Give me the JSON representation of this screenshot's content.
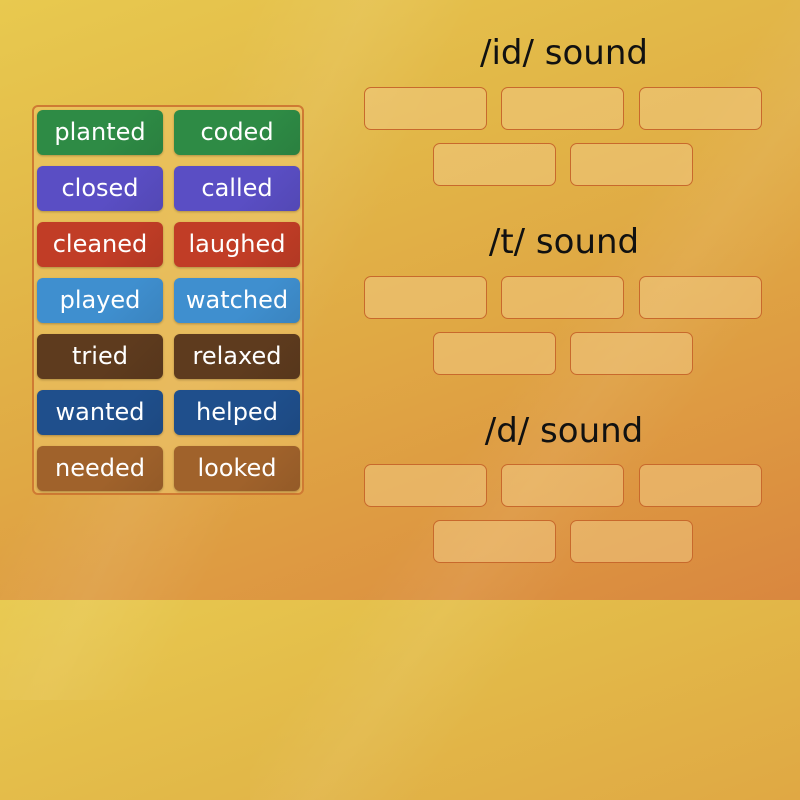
{
  "activity": "Group sort",
  "word_bank": {
    "tiles": [
      {
        "label": "planted",
        "color": "#2e8b45"
      },
      {
        "label": "coded",
        "color": "#2e8b45"
      },
      {
        "label": "closed",
        "color": "#5a4ec4"
      },
      {
        "label": "called",
        "color": "#5a4ec4"
      },
      {
        "label": "cleaned",
        "color": "#c13d26"
      },
      {
        "label": "laughed",
        "color": "#c13d26"
      },
      {
        "label": "played",
        "color": "#3f8fcf"
      },
      {
        "label": "watched",
        "color": "#3f8fcf"
      },
      {
        "label": "tried",
        "color": "#5e3b1e"
      },
      {
        "label": "relaxed",
        "color": "#5e3b1e"
      },
      {
        "label": "wanted",
        "color": "#1f4f8c"
      },
      {
        "label": "helped",
        "color": "#1f4f8c"
      },
      {
        "label": "needed",
        "color": "#a0622b"
      },
      {
        "label": "looked",
        "color": "#a0622b"
      }
    ]
  },
  "groups": [
    {
      "title": "/id/ sound",
      "slots": 5
    },
    {
      "title": "/t/ sound",
      "slots": 5
    },
    {
      "title": "/d/ sound",
      "slots": 5
    }
  ]
}
